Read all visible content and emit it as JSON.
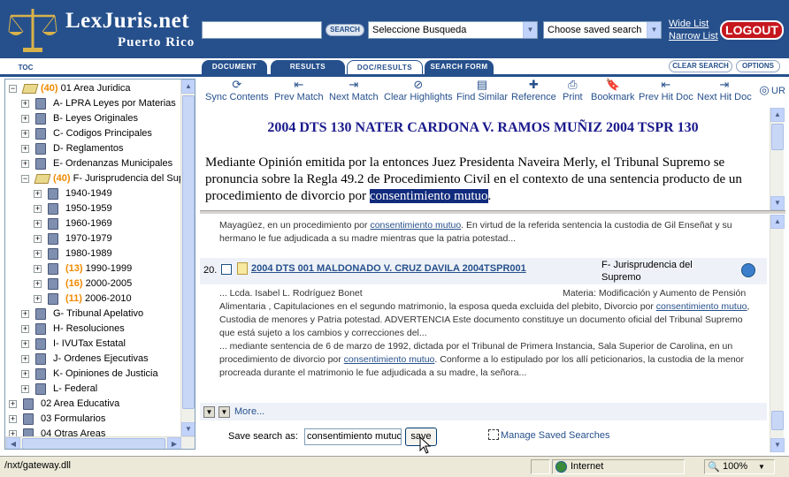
{
  "header": {
    "logo_title": "LexJuris.net",
    "logo_subtitle": "Puerto Rico",
    "search_value": "",
    "search_button": "SEARCH",
    "busqueda_select": "Seleccione Busqueda",
    "saved_search_select": "Choose saved search",
    "wide_list": "Wide List",
    "narrow_list": "Narrow List",
    "logout": "LOGOUT",
    "brand_color": "#26508c",
    "logout_color": "#c6171e"
  },
  "tabs": {
    "toc": "TOC",
    "document": "DOCUMENT",
    "results": "RESULTS",
    "doc_results": "DOC/RESULTS",
    "search_form": "SEARCH FORM",
    "clear_search": "CLEAR SEARCH",
    "options": "OPTIONS"
  },
  "toolbar": [
    {
      "label": "Sync Contents",
      "icon": "sync-icon"
    },
    {
      "label": "Prev Match",
      "icon": "prev-match-icon"
    },
    {
      "label": "Next Match",
      "icon": "next-match-icon"
    },
    {
      "label": "Clear Highlights",
      "icon": "clear-highlights-icon"
    },
    {
      "label": "Find Similar",
      "icon": "find-similar-icon"
    },
    {
      "label": "Reference",
      "icon": "reference-icon"
    },
    {
      "label": "Print",
      "icon": "print-icon"
    },
    {
      "label": "Bookmark",
      "icon": "bookmark-icon"
    },
    {
      "label": "Prev Hit Doc",
      "icon": "prev-hit-doc-icon"
    },
    {
      "label": "Next Hit Doc",
      "icon": "next-hit-doc-icon"
    },
    {
      "label": "UR",
      "icon": "url-icon"
    }
  ],
  "toc": {
    "items": [
      {
        "exp": "−",
        "count": "(40)",
        "label": "01 Area Juridica",
        "open": true
      },
      {
        "exp": "+",
        "count": "",
        "label": "A- LPRA Leyes por Materias"
      },
      {
        "exp": "+",
        "count": "",
        "label": "B- Leyes Originales"
      },
      {
        "exp": "+",
        "count": "",
        "label": "C- Codigos Principales"
      },
      {
        "exp": "+",
        "count": "",
        "label": "D- Reglamentos"
      },
      {
        "exp": "+",
        "count": "",
        "label": "E- Ordenanzas Municipales"
      },
      {
        "exp": "−",
        "count": "(40)",
        "label": "F- Jurisprudencia del Supremo",
        "open": true
      },
      {
        "exp": "+",
        "count": "",
        "label": "1940-1949"
      },
      {
        "exp": "+",
        "count": "",
        "label": "1950-1959"
      },
      {
        "exp": "+",
        "count": "",
        "label": "1960-1969"
      },
      {
        "exp": "+",
        "count": "",
        "label": "1970-1979"
      },
      {
        "exp": "+",
        "count": "",
        "label": "1980-1989"
      },
      {
        "exp": "+",
        "count": "(13)",
        "label": "1990-1999"
      },
      {
        "exp": "+",
        "count": "(16)",
        "label": "2000-2005"
      },
      {
        "exp": "+",
        "count": "(11)",
        "label": "2006-2010"
      },
      {
        "exp": "+",
        "count": "",
        "label": "G- Tribunal Apelativo"
      },
      {
        "exp": "+",
        "count": "",
        "label": "H- Resoluciones"
      },
      {
        "exp": "+",
        "count": "",
        "label": "I- IVUTax Estatal"
      },
      {
        "exp": "+",
        "count": "",
        "label": "J- Ordenes Ejecutivas"
      },
      {
        "exp": "+",
        "count": "",
        "label": "K- Opiniones de Justicia"
      },
      {
        "exp": "+",
        "count": "",
        "label": "L- Federal"
      },
      {
        "exp": "+",
        "count": "",
        "label": "02 Area Educativa"
      },
      {
        "exp": "+",
        "count": "",
        "label": "03 Formularios"
      },
      {
        "exp": "+",
        "count": "",
        "label": "04 Otras Areas"
      }
    ]
  },
  "document": {
    "title": "2004 DTS 130 NATER CARDONA V. RAMOS MUÑIZ 2004 TSPR 130",
    "body_before": "Mediante Opinión emitida por la entonces Juez Presidenta Naveira Merly, el Tribunal Supremo se pronuncia sobre la Regla 49.2 de Procedimiento Civil en el contexto de una sentencia producto de un procedimiento de divorcio por ",
    "body_highlight": "consentimiento mutuo",
    "body_after": "."
  },
  "results": {
    "prev_line1_a": "Mayagüez, en un procedimiento por ",
    "prev_line1_link": "consentimiento mutuo",
    "prev_line1_b": ". En virtud de la referida sentencia la custodia de Gil Enseñat y su",
    "prev_line2": "hermano le fue adjudicada a su madre mientras que la patria potestad...",
    "item20": {
      "num": "20.",
      "title": "2004 DTS 001 MALDONADO V. CRUZ DAVILA 2004TSPR001",
      "category": "F- Jurisprudencia del Supremo",
      "snip1_a": "... Lcda. Isabel L. Rodríguez Bonet",
      "snip1_b": "Materia: Modificación y Aumento de Pensión",
      "snip1_c": "Alimentaria , Capitulaciones en el segundo matrimonio, la esposa queda excluida del plebito, Divorcio por ",
      "snip1_link": "consentimiento mutuo",
      "snip1_d": ",",
      "snip1_e": "Custodia de menores y Patria potestad.   ADVERTENCIA Este documento constituye un documento oficial del Tribunal Supremo",
      "snip1_f": "que está sujeto a los cambios y correcciones del...",
      "snip2_a": "... mediante sentencia de 6 de marzo de 1992, dictada por el Tribunal de Primera Instancia, Sala Superior de Carolina, en un",
      "snip2_b": "procedimiento de divorcio por ",
      "snip2_link": "consentimiento mutuo",
      "snip2_c": ". Conforme a lo estipulado por los allí peticionarios, la custodia de la menor",
      "snip2_d": "procreada durante el matrimonio le fue adjudicada a su madre, la señora..."
    },
    "more": "More..."
  },
  "save": {
    "label": "Save search as:",
    "value": "consentimiento mutuo",
    "button": "save",
    "manage": "Manage Saved Searches"
  },
  "status": {
    "url": "/nxt/gateway.dll",
    "zone": "Internet",
    "zoom": "100%"
  }
}
